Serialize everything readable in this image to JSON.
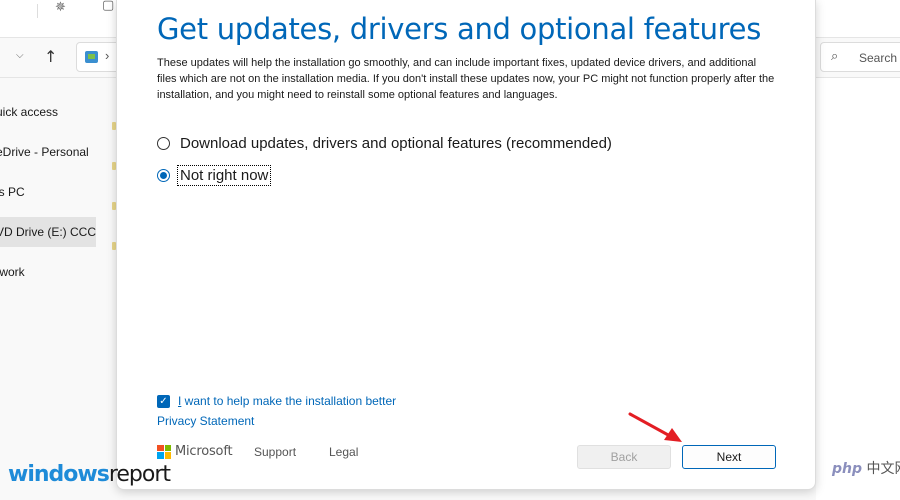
{
  "explorer": {
    "sidebar_items": [
      {
        "label": "uick access"
      },
      {
        "label": "eDrive - Personal"
      },
      {
        "label": "is PC"
      },
      {
        "label": "VD Drive (E:) CCCO"
      },
      {
        "label": "twork"
      }
    ],
    "search_placeholder": "Search"
  },
  "dialog": {
    "title": "Get updates, drivers and optional features",
    "description": "These updates will help the installation go smoothly, and can include important fixes, updated device drivers, and additional files which are not on the installation media. If you don't install these updates now, your PC might not function properly after the installation, and you might need to reinstall some optional features and languages.",
    "options": [
      {
        "label": "Download updates, drivers and optional features (recommended)",
        "selected": false
      },
      {
        "label": "Not right now",
        "selected": true
      }
    ],
    "help_checkbox": {
      "prefix": "I",
      "label": " want to help make the installation better",
      "checked": true
    },
    "privacy_link": "Privacy Statement",
    "brand": "Microsoft",
    "footer_links": [
      "Support",
      "Legal"
    ],
    "buttons": {
      "back": "Back",
      "next": "Next"
    }
  },
  "colors": {
    "accent": "#0067b8",
    "annotation_arrow": "#e31e24",
    "ms_red": "#f25022",
    "ms_green": "#7fba00",
    "ms_blue": "#00a4ef",
    "ms_yellow": "#ffb900"
  },
  "watermark": {
    "logo_part1": "windows",
    "logo_part2": "report",
    "cn_brand": "php",
    "cn_text": "中文网"
  }
}
